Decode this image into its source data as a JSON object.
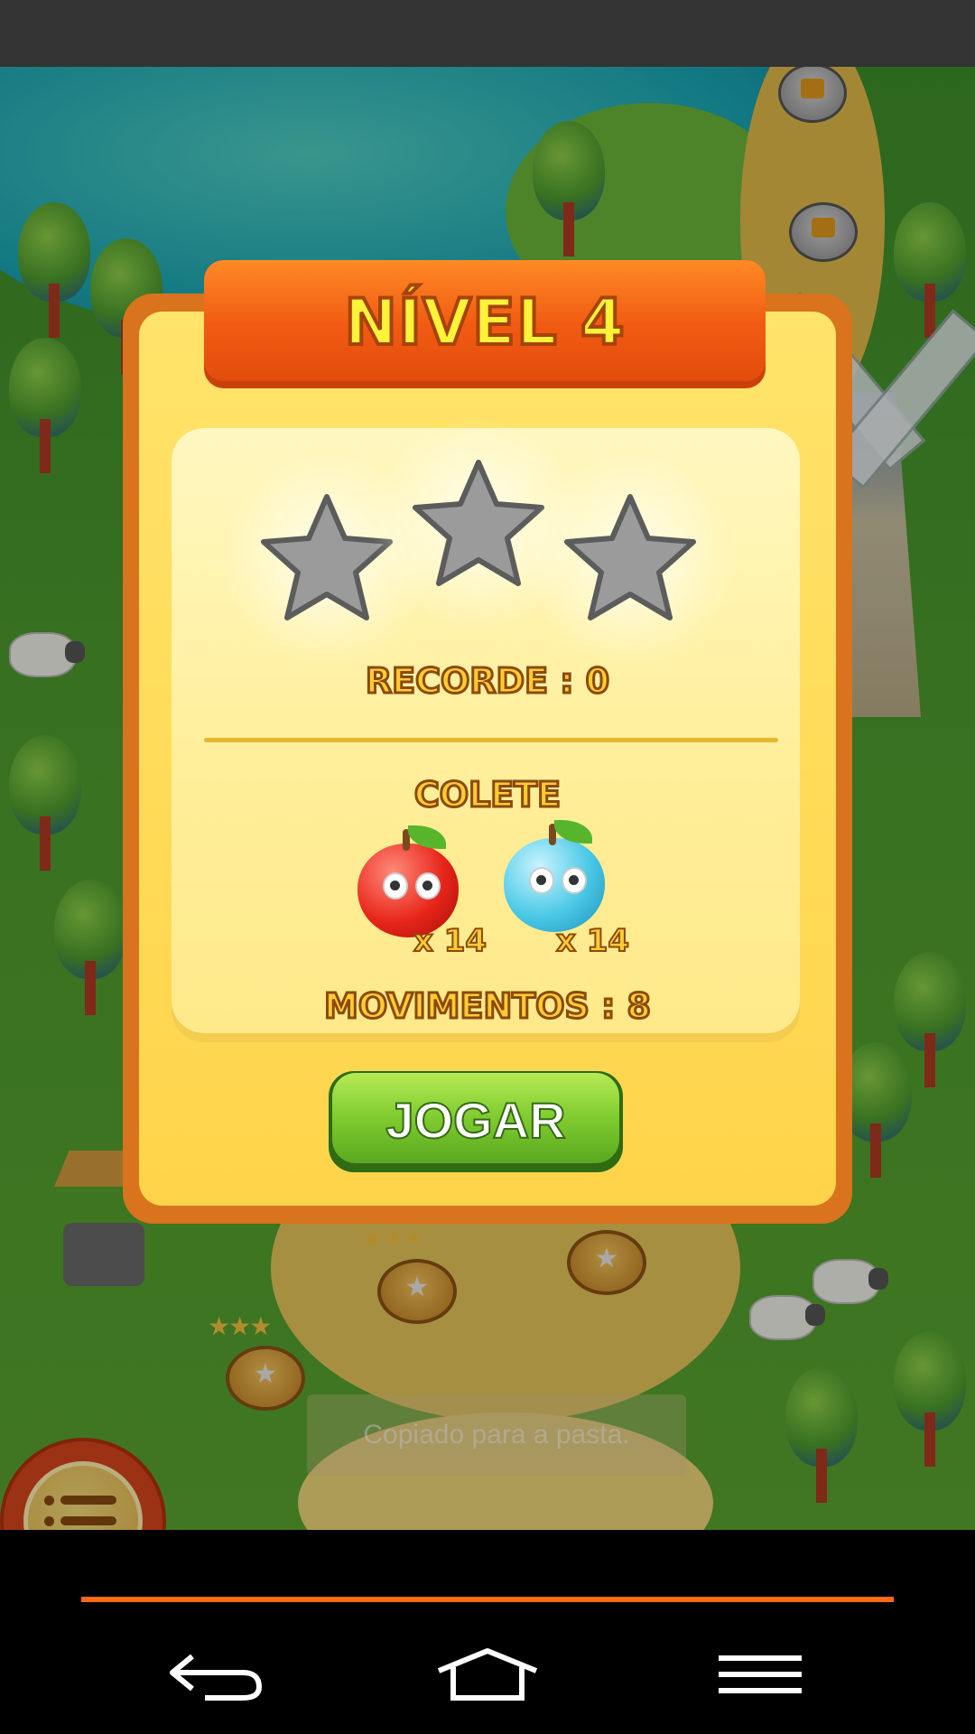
{
  "level": {
    "title": "NÍVEL 4",
    "stars_earned": 0,
    "stars_total": 3,
    "record_label": "RECORDE : 0",
    "collect_label": "COLETE",
    "targets": [
      {
        "fruit": "red-apple",
        "count_label": "x 14",
        "color": "#e8251a"
      },
      {
        "fruit": "blue-fruit",
        "count_label": "x 14",
        "color": "#49c8e6"
      }
    ],
    "moves_label": "MOVIMENTOS : 8",
    "play_button_label": "JOGAR"
  },
  "toast": {
    "text": "Copiado para a pasta."
  },
  "colors": {
    "banner": "#f05a12",
    "panel": "#ffd44a",
    "title_text": "#fff33a",
    "play_button": "#7fcb2f",
    "nav_accent": "#ff6a13"
  },
  "icons": {
    "menu": "list-icon",
    "back": "back-arrow-icon",
    "home": "home-icon",
    "recents": "menu-lines-icon",
    "map_lock": "lock-icon"
  }
}
